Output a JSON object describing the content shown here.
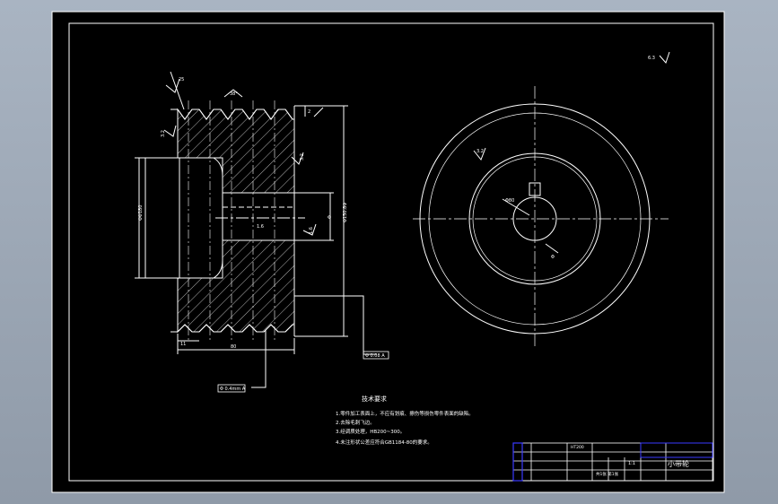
{
  "drawing": {
    "roughness_top": "25",
    "roughness_pulley": "3.2",
    "roughness_right": "3.2",
    "groove_angle": "38°",
    "roughness_keyway": "1.6",
    "roughness_bore": "1.6",
    "bore_mark": "Φ80",
    "dim_small": "2",
    "dim_groove": "11",
    "dim_width": "80",
    "dim_hub_dia": "ΦΦ180",
    "dim_bore": "Φ",
    "dim_outer": "Φ150.8Φ",
    "side_roughness": "6.3",
    "side_sym": "Φ",
    "tol_right": "Φ 0.08 A",
    "tol_bottom": "Φ 0.4mm A"
  },
  "notes": {
    "title": "技术要求",
    "items": [
      "1.零件加工表面上，不应有划痕、擦伤等损伤零件表面的缺陷。",
      "2.去除毛刺飞边。",
      "3.经调质处理，HB200~300。",
      "4.未注形状公差应符合GB1184-80的要求。"
    ]
  },
  "title_block": {
    "part_name": "小带轮",
    "scale": "1:1",
    "material": "HT200",
    "qty_label": "共1张 第1张"
  },
  "colors": {
    "bg": "#000000",
    "line": "#ffffff",
    "frame_bg": "#9aa6b4",
    "tb_accent": "#3a3aff"
  }
}
